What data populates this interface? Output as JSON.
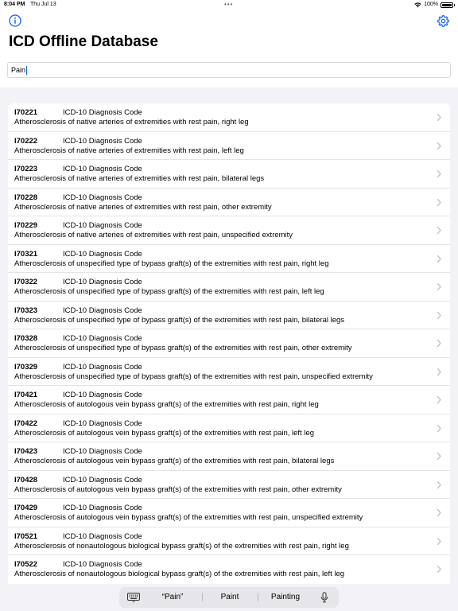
{
  "status": {
    "time": "8:04 PM",
    "date": "Thu Jul 13",
    "dots": "•••",
    "battery": "100%",
    "battery_level": 1.0,
    "wifi_icon": "wifi-icon",
    "battery_icon": "battery-icon"
  },
  "header": {
    "title": "ICD Offline Database",
    "info_icon": "info-icon",
    "settings_icon": "gear-icon"
  },
  "search": {
    "value": "Pain"
  },
  "results": [
    {
      "code": "I70221",
      "type": "ICD-10 Diagnosis Code",
      "desc": "Atherosclerosis of native arteries of extremities with rest pain, right leg"
    },
    {
      "code": "I70222",
      "type": "ICD-10 Diagnosis Code",
      "desc": "Atherosclerosis of native arteries of extremities with rest pain, left leg"
    },
    {
      "code": "I70223",
      "type": "ICD-10 Diagnosis Code",
      "desc": "Atherosclerosis of native arteries of extremities with rest pain, bilateral legs"
    },
    {
      "code": "I70228",
      "type": "ICD-10 Diagnosis Code",
      "desc": "Atherosclerosis of native arteries of extremities with rest pain, other extremity"
    },
    {
      "code": "I70229",
      "type": "ICD-10 Diagnosis Code",
      "desc": "Atherosclerosis of native arteries of extremities with rest pain, unspecified extremity"
    },
    {
      "code": "I70321",
      "type": "ICD-10 Diagnosis Code",
      "desc": "Atherosclerosis of unspecified type of bypass graft(s) of the extremities with rest pain, right leg"
    },
    {
      "code": "I70322",
      "type": "ICD-10 Diagnosis Code",
      "desc": "Atherosclerosis of unspecified type of bypass graft(s) of the extremities with rest pain, left leg"
    },
    {
      "code": "I70323",
      "type": "ICD-10 Diagnosis Code",
      "desc": "Atherosclerosis of unspecified type of bypass graft(s) of the extremities with rest pain, bilateral legs"
    },
    {
      "code": "I70328",
      "type": "ICD-10 Diagnosis Code",
      "desc": "Atherosclerosis of unspecified type of bypass graft(s) of the extremities with rest pain, other extremity"
    },
    {
      "code": "I70329",
      "type": "ICD-10 Diagnosis Code",
      "desc": "Atherosclerosis of unspecified type of bypass graft(s) of the extremities with rest pain, unspecified extremity"
    },
    {
      "code": "I70421",
      "type": "ICD-10 Diagnosis Code",
      "desc": "Atherosclerosis of autologous vein bypass graft(s) of the extremities with rest pain, right leg"
    },
    {
      "code": "I70422",
      "type": "ICD-10 Diagnosis Code",
      "desc": "Atherosclerosis of autologous vein bypass graft(s) of the extremities with rest pain, left leg"
    },
    {
      "code": "I70423",
      "type": "ICD-10 Diagnosis Code",
      "desc": "Atherosclerosis of autologous vein bypass graft(s) of the extremities with rest pain, bilateral legs"
    },
    {
      "code": "I70428",
      "type": "ICD-10 Diagnosis Code",
      "desc": "Atherosclerosis of autologous vein bypass graft(s) of the extremities with rest pain, other extremity"
    },
    {
      "code": "I70429",
      "type": "ICD-10 Diagnosis Code",
      "desc": "Atherosclerosis of autologous vein bypass graft(s) of the extremities with rest pain, unspecified extremity"
    },
    {
      "code": "I70521",
      "type": "ICD-10 Diagnosis Code",
      "desc": "Atherosclerosis of nonautologous biological bypass graft(s) of the extremities with rest pain, right leg"
    },
    {
      "code": "I70522",
      "type": "ICD-10 Diagnosis Code",
      "desc": "Atherosclerosis of nonautologous biological bypass graft(s) of the extremities with rest pain, left leg"
    }
  ],
  "row_chevron_icon": "chevron-right-icon",
  "keyboard": {
    "keyboard_icon": "keyboard-icon",
    "mic_icon": "microphone-icon",
    "suggestions": [
      "“Pain”",
      "Paint",
      "Painting"
    ]
  },
  "colors": {
    "accent": "#0a60ff",
    "background": "#f2f2f7",
    "separator": "#e4e4e8",
    "chevron": "#c4c4c8"
  }
}
